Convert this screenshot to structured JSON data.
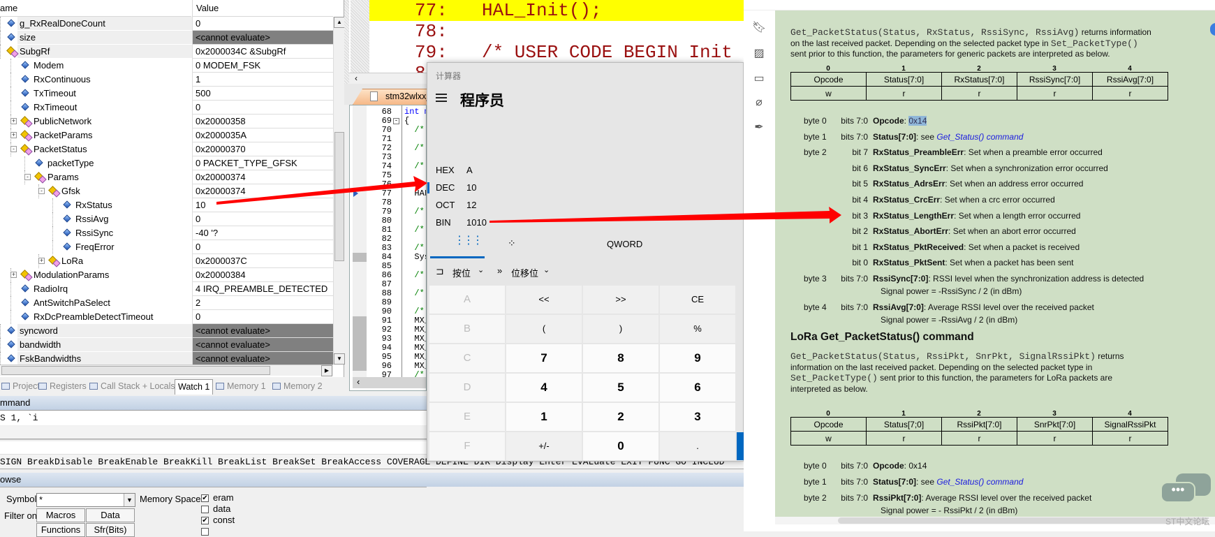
{
  "watch": {
    "col_name": "ame",
    "col_value": "Value",
    "rows": [
      {
        "name": "g_RxRealDoneCount",
        "value": "0",
        "level": 0,
        "icon": "var",
        "top": true
      },
      {
        "name": "size",
        "value": "<cannot evaluate>",
        "level": 0,
        "icon": "var",
        "top": true,
        "gray": true
      },
      {
        "name": "SubgRf",
        "value": "0x2000034C &SubgRf",
        "level": 0,
        "icon": "struct",
        "top": true
      },
      {
        "name": "Modem",
        "value": "0 MODEM_FSK",
        "level": 1,
        "icon": "var"
      },
      {
        "name": "RxContinuous",
        "value": "1",
        "level": 1,
        "icon": "var"
      },
      {
        "name": "TxTimeout",
        "value": "500",
        "level": 1,
        "icon": "var"
      },
      {
        "name": "RxTimeout",
        "value": "0",
        "level": 1,
        "icon": "var"
      },
      {
        "name": "PublicNetwork",
        "value": "0x20000358",
        "level": 1,
        "icon": "struct",
        "expand": "+"
      },
      {
        "name": "PacketParams",
        "value": "0x2000035A",
        "level": 1,
        "icon": "struct",
        "expand": "+"
      },
      {
        "name": "PacketStatus",
        "value": "0x20000370",
        "level": 1,
        "icon": "struct",
        "expand": "-"
      },
      {
        "name": "packetType",
        "value": "0 PACKET_TYPE_GFSK",
        "level": 2,
        "icon": "var"
      },
      {
        "name": "Params",
        "value": "0x20000374",
        "level": 2,
        "icon": "struct",
        "expand": "-"
      },
      {
        "name": "Gfsk",
        "value": "0x20000374",
        "level": 3,
        "icon": "struct",
        "expand": "-"
      },
      {
        "name": "RxStatus",
        "value": "10",
        "level": 4,
        "icon": "var"
      },
      {
        "name": "RssiAvg",
        "value": "0",
        "level": 4,
        "icon": "var"
      },
      {
        "name": "RssiSync",
        "value": "-40 '?",
        "level": 4,
        "icon": "var"
      },
      {
        "name": "FreqError",
        "value": "0",
        "level": 4,
        "icon": "var"
      },
      {
        "name": "LoRa",
        "value": "0x2000037C",
        "level": 3,
        "icon": "struct",
        "expand": "+"
      },
      {
        "name": "ModulationParams",
        "value": "0x20000384",
        "level": 1,
        "icon": "struct",
        "expand": "+"
      },
      {
        "name": "RadioIrq",
        "value": "4 IRQ_PREAMBLE_DETECTED",
        "level": 1,
        "icon": "var"
      },
      {
        "name": "AntSwitchPaSelect",
        "value": "2",
        "level": 1,
        "icon": "var"
      },
      {
        "name": "RxDcPreambleDetectTimeout",
        "value": "0",
        "level": 1,
        "icon": "var"
      },
      {
        "name": "syncword",
        "value": "<cannot evaluate>",
        "level": 0,
        "icon": "var",
        "top": true,
        "gray": true
      },
      {
        "name": "bandwidth",
        "value": "<cannot evaluate>",
        "level": 0,
        "icon": "var",
        "top": true,
        "gray": true
      },
      {
        "name": "FskBandwidths",
        "value": "<cannot evaluate>",
        "level": 0,
        "icon": "var",
        "top": true,
        "gray": true
      }
    ]
  },
  "bottom_tabs": [
    {
      "label": "Project",
      "icon": "project-icon"
    },
    {
      "label": "Registers",
      "icon": "registers-icon"
    },
    {
      "label": "Call Stack + Locals",
      "icon": "call-stack-icon"
    },
    {
      "label": "Watch 1",
      "active": true
    },
    {
      "label": "Memory 1",
      "icon": "memory-icon"
    },
    {
      "label": "Memory 2",
      "icon": "memory-icon"
    }
  ],
  "command": {
    "title": "mmand",
    "input": "S 1, `i",
    "hint": "SIGN BreakDisable BreakEnable BreakKill BreakList BreakSet BreakAccess COVERAGE DEFINE DIR Display Enter EVALuate EXIT FUNC GO INCLUD"
  },
  "browse": {
    "title": "owse",
    "symbol_label": "Symbol:",
    "symbol_value": "*",
    "filter_label": "Filter on:",
    "filters": [
      "Macros",
      "Data",
      "Functions",
      "Sfr(Bits)"
    ],
    "memory_label": "Memory Spaces:",
    "spaces": [
      {
        "label": "eram",
        "checked": true
      },
      {
        "label": "data",
        "checked": false
      },
      {
        "label": "const",
        "checked": true
      },
      {
        "label": "",
        "checked": false
      }
    ]
  },
  "disasm": {
    "lines": [
      {
        "no": "77:",
        "code": "HAL_Init();",
        "current": true
      },
      {
        "no": "78:",
        "code": ""
      },
      {
        "no": "79:",
        "code": "/* USER CODE BEGIN Init"
      },
      {
        "no": "8",
        "code": ""
      }
    ]
  },
  "editor": {
    "tab": "stm32wlxx_",
    "lines": [
      {
        "n": "68",
        "c": "int m",
        "k": "kw"
      },
      {
        "n": "69",
        "c": "{",
        "fold": true
      },
      {
        "n": "70",
        "c": "  /*",
        "k": "cm"
      },
      {
        "n": "71",
        "c": ""
      },
      {
        "n": "72",
        "c": "  /*",
        "k": "cm"
      },
      {
        "n": "73",
        "c": ""
      },
      {
        "n": "74",
        "c": "  /*",
        "k": "cm"
      },
      {
        "n": "75",
        "c": ""
      },
      {
        "n": "76",
        "c": "  /*",
        "k": "cm"
      },
      {
        "n": "77",
        "c": "  HAL_",
        "cur": true
      },
      {
        "n": "78",
        "c": ""
      },
      {
        "n": "79",
        "c": "  /*",
        "k": "cm"
      },
      {
        "n": "80",
        "c": ""
      },
      {
        "n": "81",
        "c": "  /*",
        "k": "cm"
      },
      {
        "n": "82",
        "c": ""
      },
      {
        "n": "83",
        "c": "  /*",
        "k": "cm"
      },
      {
        "n": "84",
        "c": "  Sys",
        "mark": true
      },
      {
        "n": "85",
        "c": ""
      },
      {
        "n": "86",
        "c": "  /*",
        "k": "cm"
      },
      {
        "n": "87",
        "c": ""
      },
      {
        "n": "88",
        "c": "  /*",
        "k": "cm"
      },
      {
        "n": "89",
        "c": ""
      },
      {
        "n": "90",
        "c": "  /*",
        "k": "cm"
      },
      {
        "n": "91",
        "c": "  MX_",
        "mark": true
      },
      {
        "n": "92",
        "c": "  MX_",
        "mark": true
      },
      {
        "n": "93",
        "c": "  MX_",
        "mark": true
      },
      {
        "n": "94",
        "c": "  MX_",
        "mark": true
      },
      {
        "n": "95",
        "c": "  MX_",
        "mark": true
      },
      {
        "n": "96",
        "c": "  MX_",
        "mark": true
      },
      {
        "n": "97",
        "c": "  /*",
        "k": "cm"
      }
    ]
  },
  "calculator": {
    "app_title": "计算器",
    "mode": "程序员",
    "radix": [
      {
        "label": "HEX",
        "value": "A"
      },
      {
        "label": "DEC",
        "value": "10",
        "selected": true
      },
      {
        "label": "OCT",
        "value": "12"
      },
      {
        "label": "BIN",
        "value": "1010"
      }
    ],
    "word_size": "QWORD",
    "bitwise": "按位",
    "bitshift": "位移位",
    "keys": [
      [
        "A",
        "<<",
        ">>",
        "CE"
      ],
      [
        "B",
        "(",
        ")",
        "%"
      ],
      [
        "C",
        "7",
        "8",
        "9"
      ],
      [
        "D",
        "4",
        "5",
        "6"
      ],
      [
        "E",
        "1",
        "2",
        "3"
      ],
      [
        "F",
        "+/-",
        "0",
        "."
      ]
    ],
    "accent": "#0067c0"
  },
  "pdf": {
    "intro": {
      "l1_code": "Get_PacketStatus(Status, RxStatus, RssiSync, RssiAvg)",
      "l1_text": " returns information",
      "l2_text": "on the last received packet. Depending on the selected packet type in ",
      "l2_code": "Set_PacketType()",
      "l3_text": "sent prior to this function, the parameters for generic packets are interpreted as below."
    },
    "table1": {
      "nums": [
        "0",
        "1",
        "2",
        "3",
        "4"
      ],
      "head": [
        "Opcode",
        "Status[7:0]",
        "RxStatus[7:0]",
        "RssiSync[7:0]",
        "RssiAvg[7:0]"
      ],
      "access": [
        "w",
        "r",
        "r",
        "r",
        "r"
      ]
    },
    "fields1": [
      {
        "byte": "byte 0",
        "bits": "bits 7:0",
        "name": "Opcode",
        "desc": ": ",
        "hl": "0x14"
      },
      {
        "byte": "byte 1",
        "bits": "bits 7:0",
        "name": "Status[7:0]",
        "desc": ": see ",
        "link": "Get_Status() command"
      },
      {
        "byte": "byte 2",
        "bits": "bit 7",
        "name": "RxStatus_PreambleErr",
        "desc": ": Set when a preamble error occurred"
      },
      {
        "byte": "",
        "bits": "bit 6",
        "name": "RxStatus_SyncErr",
        "desc": ": Set when a synchronization error occurred"
      },
      {
        "byte": "",
        "bits": "bit 5",
        "name": "RxStatus_AdrsErr",
        "desc": ": Set when an address error occurred"
      },
      {
        "byte": "",
        "bits": "bit 4",
        "name": "RxStatus_CrcErr",
        "desc": ": Set when a crc error occurred"
      },
      {
        "byte": "",
        "bits": "bit 3",
        "name": "RxStatus_LengthErr",
        "desc": ": Set when a length error occurred"
      },
      {
        "byte": "",
        "bits": "bit 2",
        "name": "RxStatus_AbortErr",
        "desc": ": Set when an abort error occurred"
      },
      {
        "byte": "",
        "bits": "bit 1",
        "name": "RxStatus_PktReceived",
        "desc": ": Set when a packet is received"
      },
      {
        "byte": "",
        "bits": "bit 0",
        "name": "RxStatus_PktSent",
        "desc": ": Set when a packet has been sent"
      },
      {
        "byte": "byte 3",
        "bits": "bits 7:0",
        "name": "RssiSync[7:0]",
        "desc": ": RSSI level when the synchronization address is detected",
        "sub": "Signal power = -RssiSync / 2 (in dBm)"
      },
      {
        "byte": "byte 4",
        "bits": "bits 7:0",
        "name": "RssiAvg[7:0]",
        "desc": ": Average RSSI level over the received packet",
        "sub": "Signal power = -RssiAvg / 2 (in dBm)"
      }
    ],
    "heading": "LoRa Get_PacketStatus() command",
    "intro2": {
      "l1_code": "Get_PacketStatus(Status, RssiPkt, SnrPkt, SignalRssiPkt)",
      "l1_text": " returns",
      "l2_text": "information on the last received packet. Depending on the selected packet type in",
      "l3_code": "Set_PacketType()",
      "l3_text": " sent prior to this function, the parameters for LoRa packets are",
      "l4_text": "interpreted as below."
    },
    "table2": {
      "nums": [
        "0",
        "1",
        "2",
        "3",
        "4"
      ],
      "head": [
        "Opcode",
        "Status[7;0]",
        "RssiPkt[7:0]",
        "SnrPkt[7:0]",
        "SignalRssiPkt"
      ],
      "access": [
        "w",
        "r",
        "r",
        "r",
        "r"
      ]
    },
    "fields2": [
      {
        "byte": "byte 0",
        "bits": "bits 7:0",
        "name": "Opcode",
        "desc": ": 0x14"
      },
      {
        "byte": "byte 1",
        "bits": "bits 7:0",
        "name": "Status[7:0]",
        "desc": ": see ",
        "link": "Get_Status() command"
      },
      {
        "byte": "byte 2",
        "bits": "bits 7:0",
        "name": "RssiPkt[7:0]",
        "desc": ": Average RSSI level over the received packet",
        "sub": "Signal power = - RssiPkt / 2 (in dBm)"
      }
    ],
    "watermark": "ST中文论坛",
    "page_color": "#cfdfc5"
  },
  "annotation_color": "#ff0000"
}
